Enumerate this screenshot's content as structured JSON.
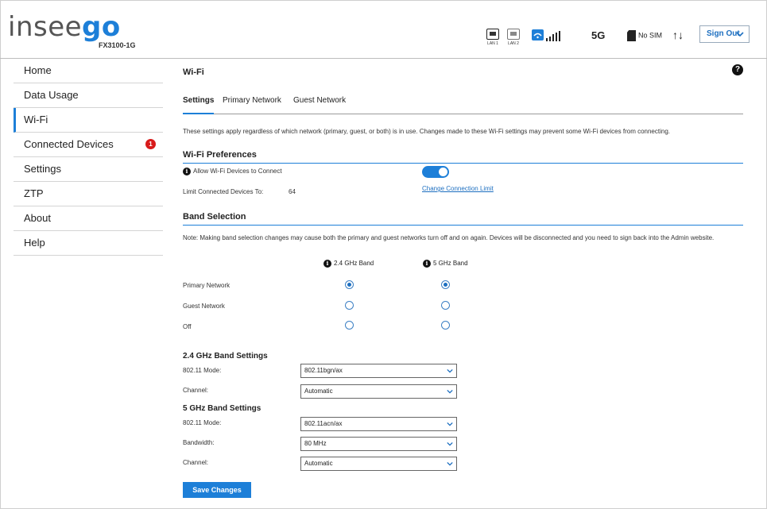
{
  "header": {
    "logo_text": "insee",
    "logo_accent": "go",
    "model": "FX3100-1G",
    "lan1": "LAN 1",
    "lan2": "LAN 2",
    "network_type": "5G",
    "sim_status": "No SIM",
    "sign_out": "Sign Out",
    "brand_color": "#1d7fd8"
  },
  "sidebar": {
    "items": [
      {
        "label": "Home"
      },
      {
        "label": "Data Usage"
      },
      {
        "label": "Wi-Fi"
      },
      {
        "label": "Connected Devices",
        "badge": "1"
      },
      {
        "label": "Settings"
      },
      {
        "label": "ZTP"
      },
      {
        "label": "About"
      },
      {
        "label": "Help"
      }
    ],
    "active": "Wi-Fi"
  },
  "main": {
    "title": "Wi-Fi",
    "help": "?",
    "tabs": [
      {
        "label": "Settings"
      },
      {
        "label": "Primary Network"
      },
      {
        "label": "Guest Network"
      }
    ],
    "intro": "These settings apply regardless of which network (primary, guest, or both) is in use. Changes made to these Wi-Fi settings may prevent some Wi-Fi devices from connecting.",
    "preferences": {
      "heading": "Wi-Fi Preferences",
      "allow_label": "Allow Wi-Fi Devices to Connect",
      "allow_enabled": true,
      "limit_label": "Limit Connected Devices To:",
      "limit_value": "64",
      "change_link": "Change Connection Limit"
    },
    "band_selection": {
      "heading": "Band Selection",
      "note": "Note: Making band selection changes may cause both the primary and guest networks turn off and on again. Devices will be disconnected and you need to sign back into the Admin website.",
      "band_24": "2.4 GHz Band",
      "band_5": "5 GHz Band",
      "rows": [
        {
          "label": "Primary Network",
          "band24": true,
          "band5": true
        },
        {
          "label": "Guest Network",
          "band24": false,
          "band5": false
        },
        {
          "label": "Off",
          "band24": false,
          "band5": false
        }
      ]
    },
    "band24_settings": {
      "heading": "2.4 GHz Band Settings",
      "mode_label": "802.11 Mode:",
      "mode_value": "802.11bgn/ax",
      "channel_label": "Channel:",
      "channel_value": "Automatic"
    },
    "band5_settings": {
      "heading": "5 GHz Band Settings",
      "mode_label": "802.11 Mode:",
      "mode_value": "802.11acn/ax",
      "bandwidth_label": "Bandwidth:",
      "bandwidth_value": "80 MHz",
      "channel_label": "Channel:",
      "channel_value": "Automatic"
    },
    "save_label": "Save Changes"
  }
}
